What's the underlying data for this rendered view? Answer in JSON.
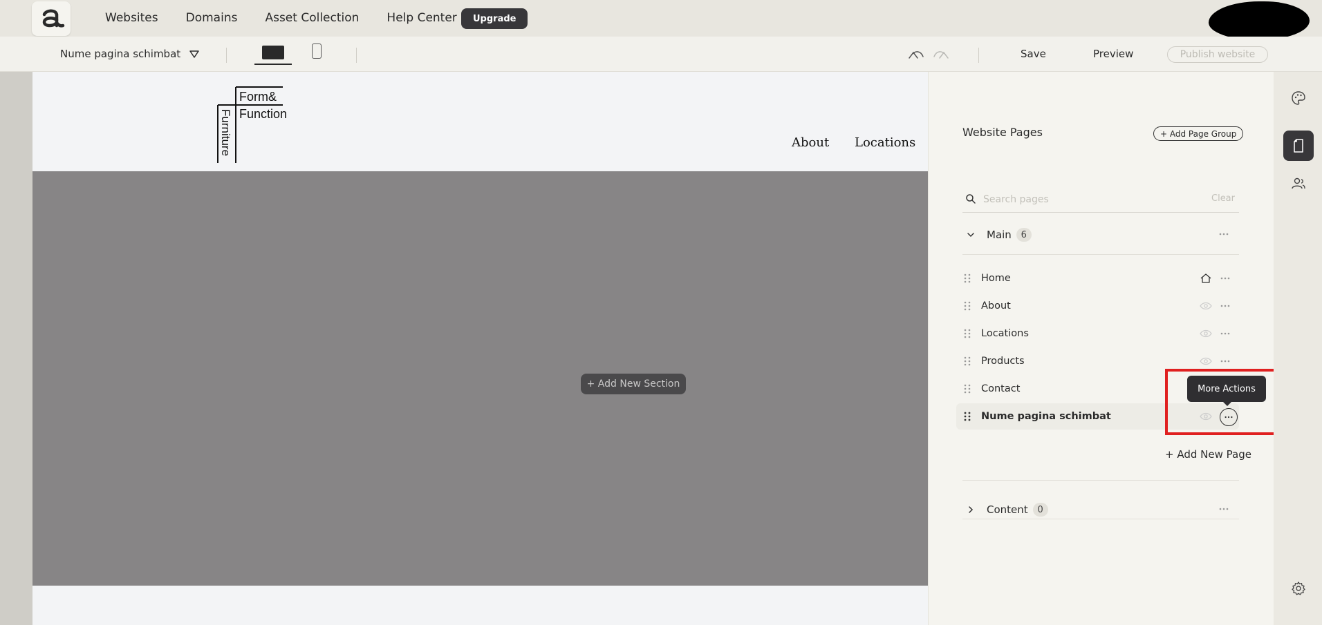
{
  "topbar": {
    "logo_icon": "a-brand-logo-icon",
    "nav": [
      "Websites",
      "Domains",
      "Asset Collection",
      "Help Center"
    ],
    "upgrade_label": "Upgrade"
  },
  "toolbar": {
    "page_select_value": "Nume pagina schimbat",
    "save_label": "Save",
    "preview_label": "Preview",
    "publish_label": "Publish website"
  },
  "canvas": {
    "logo": {
      "line1": "Form&",
      "line2": "Function",
      "vertical": "Furniture"
    },
    "nav": [
      "About",
      "Locations"
    ],
    "add_section_label": "+ Add New Section"
  },
  "panel": {
    "title": "Website Pages",
    "add_group_label": "+ Add Page Group",
    "search_placeholder": "Search pages",
    "clear_label": "Clear",
    "groups": [
      {
        "name": "Main",
        "count": "6",
        "expanded": true
      },
      {
        "name": "Content",
        "count": "0",
        "expanded": false
      }
    ],
    "pages": [
      {
        "name": "Home",
        "status_icon": "home-icon"
      },
      {
        "name": "About",
        "status_icon": "eye-icon"
      },
      {
        "name": "Locations",
        "status_icon": "eye-icon"
      },
      {
        "name": "Products",
        "status_icon": "eye-icon"
      },
      {
        "name": "Contact",
        "status_icon": "eye-icon"
      },
      {
        "name": "Nume pagina schimbat",
        "status_icon": "eye-icon",
        "active": true
      }
    ],
    "add_page_label": "+ Add New Page",
    "tooltip": "More Actions"
  },
  "rail": {
    "icons": [
      "palette-icon",
      "page-icon",
      "users-icon",
      "gear-icon"
    ]
  },
  "colors": {
    "dark": "#38373a",
    "hero": "#878586",
    "highlight": "#e02020"
  }
}
